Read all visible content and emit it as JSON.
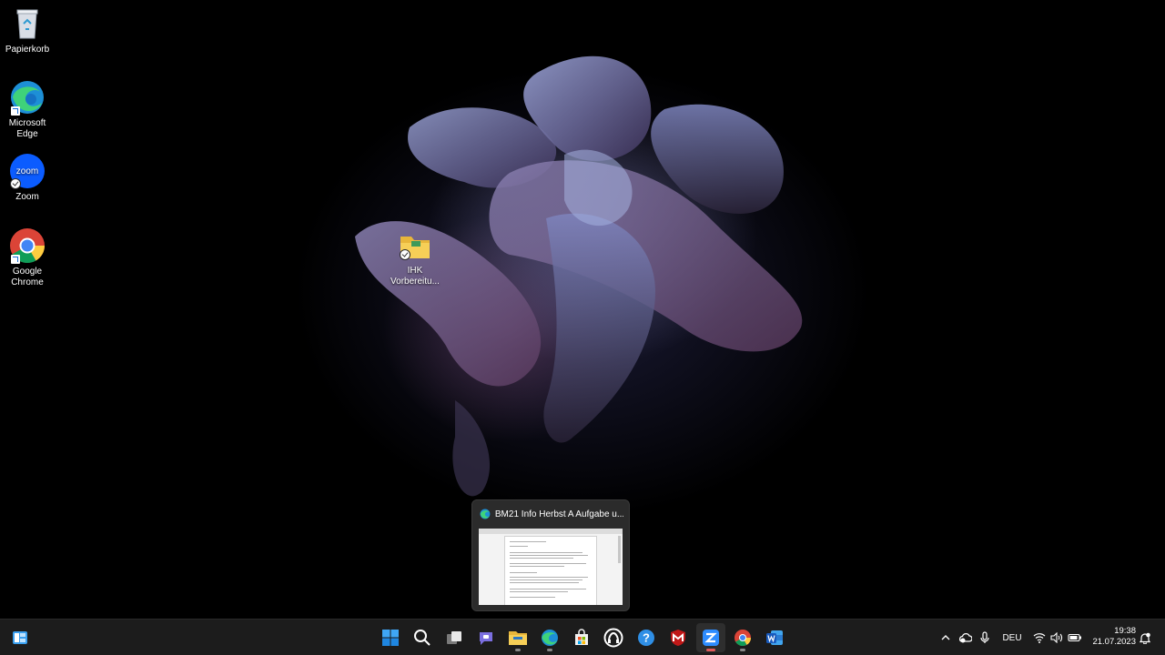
{
  "desktop": {
    "icons": [
      {
        "label": "Papierkorb",
        "icon": "recycle-bin-icon"
      },
      {
        "label": "Microsoft Edge",
        "icon": "edge-icon"
      },
      {
        "label": "Zoom",
        "icon": "zoom-icon",
        "badge_text": "zoom"
      },
      {
        "label": "Google Chrome",
        "icon": "chrome-icon"
      },
      {
        "label": "IHK Vorbereitu...",
        "icon": "folder-icon"
      }
    ]
  },
  "preview": {
    "title": "BM21 Info Herbst A Aufgabe u..."
  },
  "taskbar": {
    "apps": [
      "widgets-icon",
      "start-icon",
      "search-icon",
      "task-view-icon",
      "chat-icon",
      "file-explorer-icon",
      "edge-icon",
      "store-icon",
      "app-icon",
      "help-icon",
      "mcafee-icon",
      "zoom-icon",
      "chrome-icon",
      "word-icon"
    ],
    "tray": {
      "language": "DEU",
      "time": "19:38",
      "date": "21.07.2023"
    }
  },
  "colors": {
    "taskbar_bg": "#1c1c1c",
    "accent": "#0078d4"
  }
}
